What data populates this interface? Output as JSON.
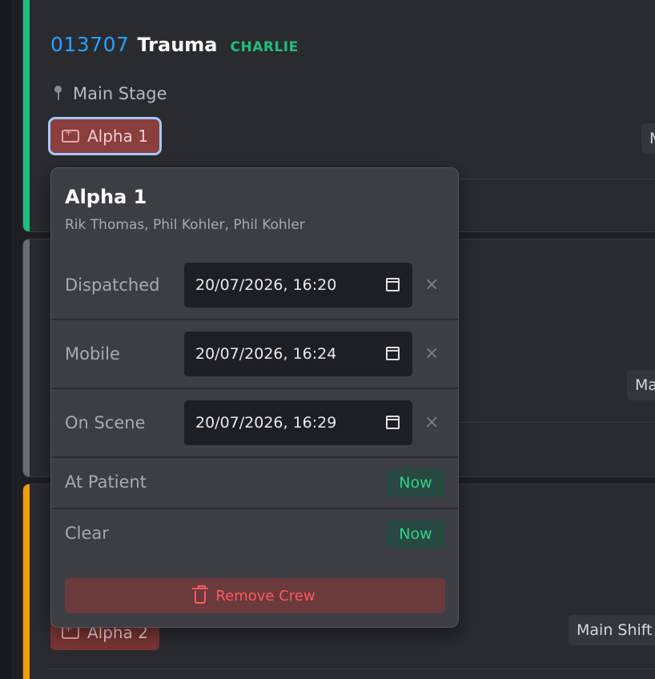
{
  "incident": {
    "id": "013707",
    "type": "Trauma",
    "code": "CHARLIE",
    "location": "Main Stage",
    "unit": "Alpha 1"
  },
  "side_tags": [
    "M",
    "Ma",
    "Main Shift"
  ],
  "second_unit": "Alpha 2",
  "popover": {
    "title": "Alpha 1",
    "crew": "Rik Thomas, Phil Kohler, Phil Kohler",
    "rows": [
      {
        "label": "Dispatched",
        "value": "20/07/2026, 16:20"
      },
      {
        "label": "Mobile",
        "value": "20/07/2026, 16:24"
      },
      {
        "label": "On Scene",
        "value": "20/07/2026, 16:29"
      },
      {
        "label": "At Patient",
        "button": "Now"
      },
      {
        "label": "Clear",
        "button": "Now"
      }
    ],
    "clear_symbol": "×",
    "remove_label": "Remove Crew"
  },
  "colors": {
    "accent_green": "#1fbf7a",
    "accent_grey": "#6b6c72",
    "accent_orange": "#f59f0b",
    "unit_red": "#8a3e3e",
    "id_blue": "#2aa0ff"
  }
}
